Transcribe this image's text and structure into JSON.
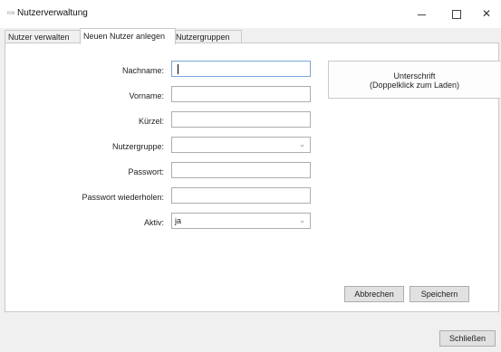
{
  "window": {
    "app_icon_text": "Kiltr",
    "title": "Nutzerverwaltung",
    "minimize": "",
    "maximize": "",
    "close": "✕"
  },
  "tabs": [
    {
      "label": "Nutzer verwalten",
      "active": false
    },
    {
      "label": "Neuen Nutzer anlegen",
      "active": true
    },
    {
      "label": "Nutzergruppen",
      "active": false
    }
  ],
  "form": {
    "nachname_label": "Nachname:",
    "nachname_value": "",
    "vorname_label": "Vorname:",
    "vorname_value": "",
    "kuerzel_label": "Kürzel:",
    "kuerzel_value": "",
    "gruppe_label": "Nutzergruppe:",
    "gruppe_value": "",
    "passwort_label": "Passwort:",
    "passwort_value": "",
    "passwort2_label": "Passwort wiederholen:",
    "passwort2_value": "",
    "aktiv_label": "Aktiv:",
    "aktiv_value": "ja"
  },
  "signature": {
    "line1": "Unterschrift",
    "line2": "(Doppelklick zum Laden)"
  },
  "buttons": {
    "cancel": "Abbrechen",
    "save": "Speichern",
    "close": "Schließen"
  },
  "icons": {
    "app": "app-icon",
    "dropdown": "chevron-down-icon"
  }
}
